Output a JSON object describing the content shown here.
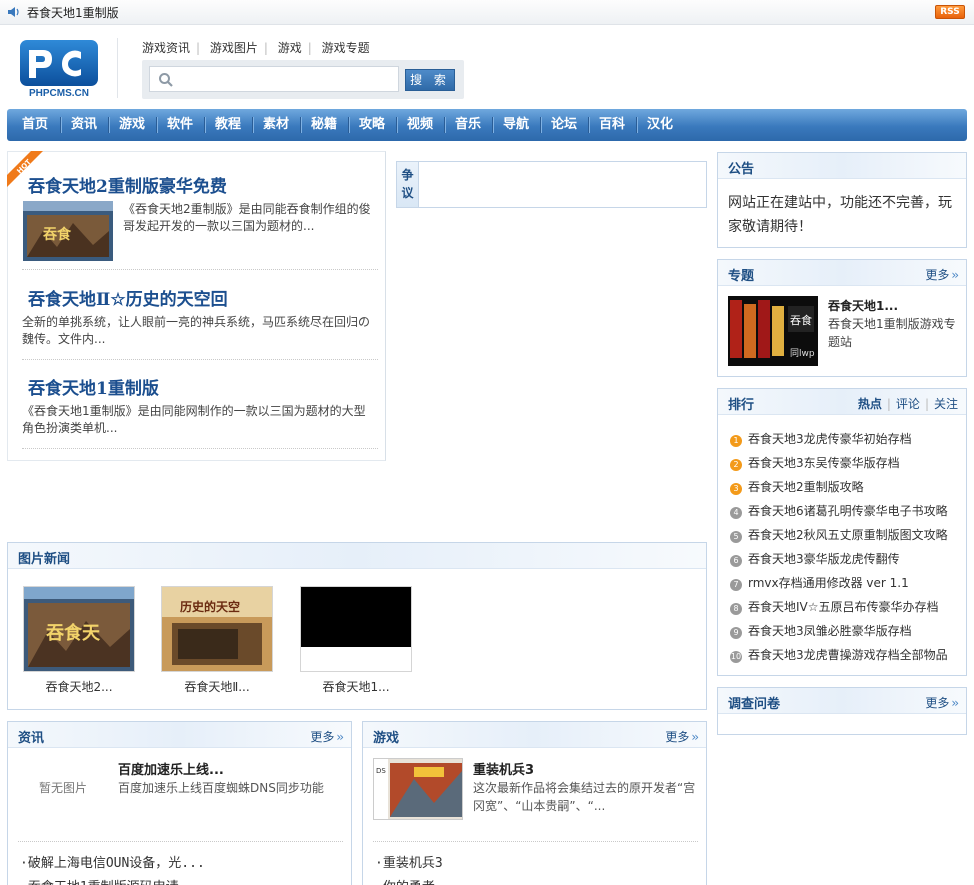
{
  "window": {
    "title": "吞食天地1重制版",
    "rss": "RSS"
  },
  "header": {
    "logo_text": "PHPCMS.CN",
    "links": [
      "游戏资讯",
      "游戏图片",
      "游戏",
      "游戏专题"
    ],
    "search": {
      "placeholder": "",
      "button": "搜 索"
    }
  },
  "nav": [
    "首页",
    "资讯",
    "游戏",
    "软件",
    "教程",
    "素材",
    "秘籍",
    "攻略",
    "视频",
    "音乐",
    "导航",
    "论坛",
    "百科",
    "汉化"
  ],
  "headlines": {
    "hot_label": "HOT",
    "items": [
      {
        "title": "吞食天地2重制版豪华免费",
        "desc": "《吞食天地2重制版》是由同能吞食制作组的俊哥发起开发的一款以三国为题材的..."
      },
      {
        "title": "吞食天地Ⅱ☆历史的天空回",
        "desc": "全新的单挑系统，让人眼前一亮的神兵系统，马匹系统尽在回归の魏传。文件内..."
      },
      {
        "title": "吞食天地1重制版",
        "desc": "《吞食天地1重制版》是由同能网制作的一款以三国为题材的大型角色扮演类单机..."
      }
    ]
  },
  "debate": {
    "label": "争议"
  },
  "notice": {
    "title": "公告",
    "text": "网站正在建站中，功能还不完善，玩家敬请期待！"
  },
  "special": {
    "title": "专题",
    "more": "更多",
    "item_title": "吞食天地1...",
    "item_desc": "吞食天地1重制版游戏专题站"
  },
  "ranking": {
    "title": "排行",
    "tabs": [
      "热点",
      "评论",
      "关注"
    ],
    "items": [
      "吞食天地3龙虎传豪华初始存档",
      "吞食天地3东吴传豪华版存档",
      "吞食天地2重制版攻略",
      "吞食天地6诸葛孔明传豪华电子书攻略",
      "吞食天地2秋风五丈原重制版图文攻略",
      "吞食天地3豪华版龙虎传翻传",
      "rmvx存档通用修改器 ver 1.1",
      "吞食天地IV☆五原吕布传豪华办存档",
      "吞食天地3凤雏必胜豪华版存档",
      "吞食天地3龙虎曹操游戏存档全部物品"
    ]
  },
  "survey": {
    "title": "调查问卷",
    "more": "更多"
  },
  "photo_news": {
    "title": "图片新闻",
    "items": [
      "吞食天地2...",
      "吞食天地Ⅱ...",
      "吞食天地1..."
    ]
  },
  "info": {
    "title": "资讯",
    "more": "更多",
    "placeholder": "暂无图片",
    "feature_title": "百度加速乐上线...",
    "feature_desc": "百度加速乐上线百度蜘蛛DNS同步功能",
    "list": [
      "·破解上海电信OUN设备，光...",
      "·吞食天地1重制版源码申请"
    ]
  },
  "games": {
    "title": "游戏",
    "more": "更多",
    "feature_title": "重装机兵3",
    "feature_desc": "这次最新作品将会集结过去的原开发者“宫冈宽”、“山本贵嗣”、“...",
    "list": [
      "·重装机兵3",
      "·你的勇者"
    ]
  },
  "colors": {
    "brand_blue": "#1c4f8f",
    "nav_blue": "#3a79bd",
    "hot_orange": "#f39a1a"
  }
}
